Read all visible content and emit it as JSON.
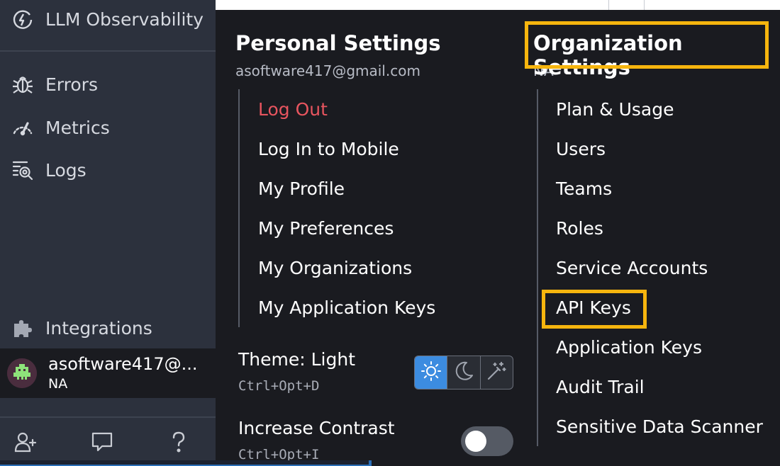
{
  "sidebar": {
    "items": [
      {
        "label": "LLM Observability",
        "icon": "llm-observability-icon"
      },
      {
        "label": "Errors",
        "icon": "bug-icon"
      },
      {
        "label": "Metrics",
        "icon": "gauge-icon"
      },
      {
        "label": "Logs",
        "icon": "logs-icon"
      },
      {
        "label": "Integrations",
        "icon": "puzzle-icon"
      }
    ],
    "user": {
      "email": "asoftware417@...",
      "org": "NA"
    },
    "bottom_icons": [
      "add-user-icon",
      "chat-icon",
      "help-icon"
    ]
  },
  "personal": {
    "title": "Personal Settings",
    "email": "asoftware417@gmail.com",
    "items": [
      "Log Out",
      "Log In to Mobile",
      "My Profile",
      "My Preferences",
      "My Organizations",
      "My Application Keys"
    ],
    "theme": {
      "label": "Theme: Light",
      "shortcut": "Ctrl+Opt+D",
      "options": [
        "light-icon",
        "dark-icon",
        "auto-icon"
      ],
      "selected": "light"
    },
    "contrast": {
      "label": "Increase Contrast",
      "shortcut": "Ctrl+Opt+I",
      "enabled": false
    }
  },
  "organization": {
    "title": "Organization Settings",
    "org_name": "NA",
    "items": [
      "Plan & Usage",
      "Users",
      "Teams",
      "Roles",
      "Service Accounts",
      "API Keys",
      "Application Keys",
      "Audit Trail",
      "Sensitive Data Scanner"
    ],
    "highlighted": "API Keys"
  },
  "colors": {
    "sidebar_bg": "#2c313d",
    "panel_bg": "#1a1b20",
    "danger": "#e8555f",
    "highlight": "#f6b50e",
    "accent": "#3c8ce0"
  }
}
